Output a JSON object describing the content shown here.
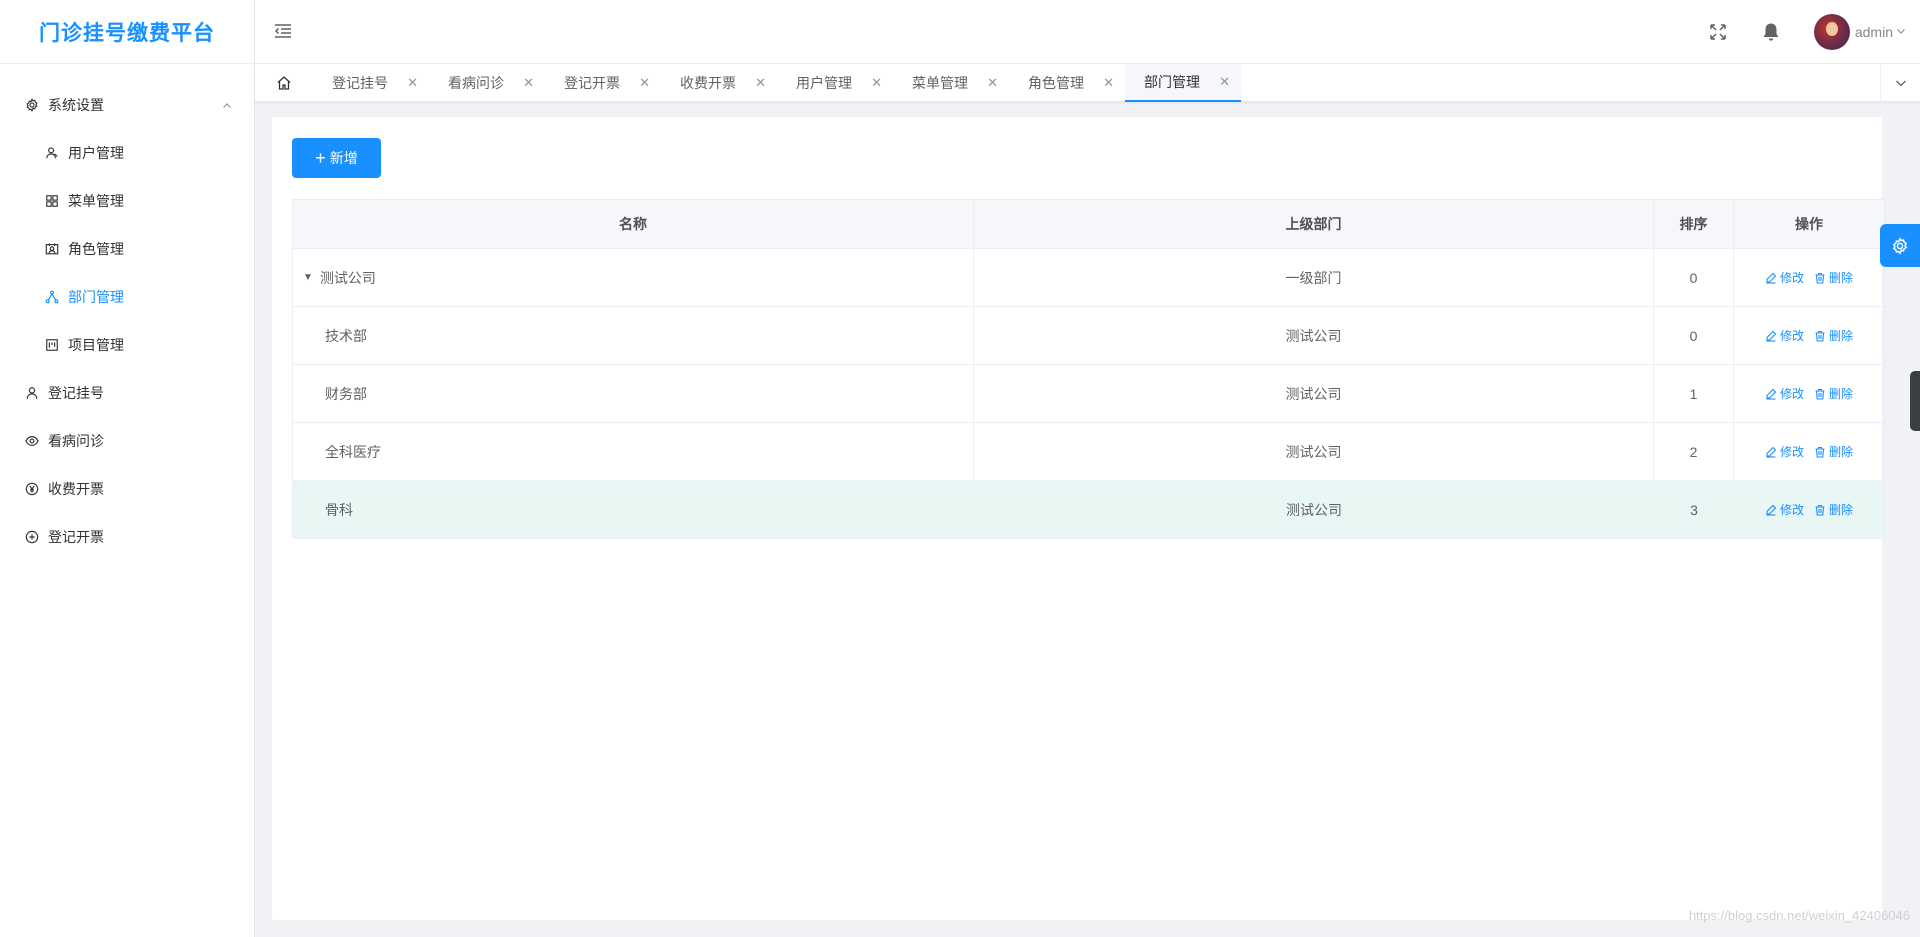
{
  "app": {
    "title": "门诊挂号缴费平台"
  },
  "sidebar": {
    "items": [
      {
        "label": "系统设置",
        "icon": "gear-icon",
        "level": 0,
        "expanded": true
      },
      {
        "label": "用户管理",
        "icon": "user-icon",
        "level": 1
      },
      {
        "label": "菜单管理",
        "icon": "grid-icon",
        "level": 1
      },
      {
        "label": "角色管理",
        "icon": "role-icon",
        "level": 1
      },
      {
        "label": "部门管理",
        "icon": "tree-icon",
        "level": 1,
        "active": true
      },
      {
        "label": "项目管理",
        "icon": "project-icon",
        "level": 1
      },
      {
        "label": "登记挂号",
        "icon": "person-icon",
        "level": 0
      },
      {
        "label": "看病问诊",
        "icon": "eye-icon",
        "level": 0
      },
      {
        "label": "收费开票",
        "icon": "yen-icon",
        "level": 0
      },
      {
        "label": "登记开票",
        "icon": "plus-circle-icon",
        "level": 0
      }
    ]
  },
  "header": {
    "username": "admin"
  },
  "tabs": [
    {
      "label": "登记挂号"
    },
    {
      "label": "看病问诊"
    },
    {
      "label": "登记开票"
    },
    {
      "label": "收费开票"
    },
    {
      "label": "用户管理"
    },
    {
      "label": "菜单管理"
    },
    {
      "label": "角色管理"
    },
    {
      "label": "部门管理",
      "active": true
    }
  ],
  "toolbar": {
    "add_label": "新增"
  },
  "table": {
    "headers": {
      "name": "名称",
      "parent": "上级部门",
      "order": "排序",
      "ops": "操作"
    },
    "edit_label": "修改",
    "delete_label": "删除",
    "rows": [
      {
        "name": "测试公司",
        "parent": "一级部门",
        "order": "0"
      },
      {
        "name": "技术部",
        "parent": "测试公司",
        "order": "0"
      },
      {
        "name": "财务部",
        "parent": "测试公司",
        "order": "1"
      },
      {
        "name": "全科医疗",
        "parent": "测试公司",
        "order": "2"
      },
      {
        "name": "骨科",
        "parent": "测试公司",
        "order": "3"
      }
    ]
  },
  "watermark": "https://blog.csdn.net/weixin_42406046",
  "colors": {
    "accent": "#1890ff",
    "highlight_row": "#e8f6f4"
  }
}
